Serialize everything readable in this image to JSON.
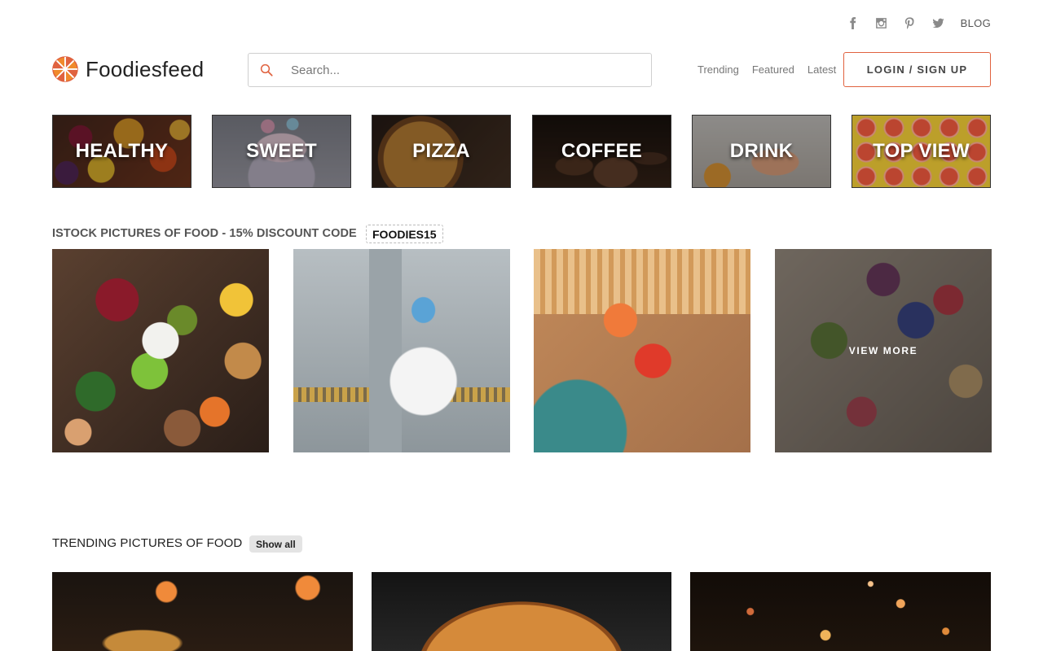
{
  "top_links": {
    "social_icons": [
      "facebook-icon",
      "instagram-icon",
      "pinterest-icon",
      "twitter-icon"
    ],
    "blog": "BLOG"
  },
  "header": {
    "logo_text": "Foodiesfeed",
    "search_placeholder": "Search...",
    "nav": [
      "Trending",
      "Featured",
      "Latest"
    ],
    "login_label": "LOGIN / SIGN UP"
  },
  "categories": [
    "HEALTHY",
    "SWEET",
    "PIZZA",
    "COFFEE",
    "DRINK",
    "TOP VIEW"
  ],
  "istock": {
    "title": "ISTOCK PICTURES OF FOOD - 15% DISCOUNT CODE",
    "code": "FOODIES15",
    "view_more": "VIEW MORE"
  },
  "trending": {
    "title": "TRENDING PICTURES OF FOOD",
    "show_all": "Show all"
  },
  "colors": {
    "accent": "#e0623f",
    "logo_orange": "#f08a2c"
  }
}
